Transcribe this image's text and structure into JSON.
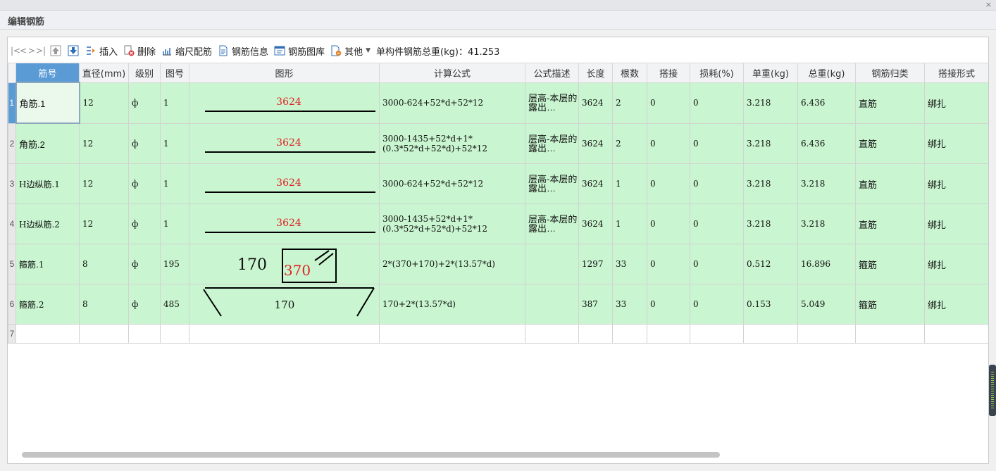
{
  "window": {
    "title": "编辑钢筋",
    "close_glyph": "×"
  },
  "toolbar": {
    "nav": [
      "|<",
      "<",
      ">",
      ">|"
    ],
    "insert": "插入",
    "delete": "删除",
    "scale_rebar": "缩尺配筋",
    "rebar_info": "钢筋信息",
    "rebar_library": "钢筋图库",
    "other": "其他",
    "total_weight": "单构件钢筋总重(kg)：41.253"
  },
  "table": {
    "columns": [
      "筋号",
      "直径(mm)",
      "级别",
      "图号",
      "图形",
      "计算公式",
      "公式描述",
      "长度",
      "根数",
      "搭接",
      "损耗(%)",
      "单重(kg)",
      "总重(kg)",
      "钢筋归类",
      "搭接形式"
    ],
    "rows": [
      {
        "num": "1",
        "name": "角筋.1",
        "dia": "12",
        "grade": "ф",
        "fig": "1",
        "shape": {
          "kind": "line",
          "label": "3624"
        },
        "formula": "3000-624+52*d+52*12",
        "desc": "层高-本层的露出…",
        "len": "3624",
        "count": "2",
        "lap": "0",
        "loss": "0",
        "unit_w": "3.218",
        "total_w": "6.436",
        "cat": "直筋",
        "lap_type": "绑扎"
      },
      {
        "num": "2",
        "name": "角筋.2",
        "dia": "12",
        "grade": "ф",
        "fig": "1",
        "shape": {
          "kind": "line",
          "label": "3624"
        },
        "formula": "3000-1435+52*d+1*(0.3*52*d+52*d)+52*12",
        "desc": "层高-本层的露出…",
        "len": "3624",
        "count": "2",
        "lap": "0",
        "loss": "0",
        "unit_w": "3.218",
        "total_w": "6.436",
        "cat": "直筋",
        "lap_type": "绑扎"
      },
      {
        "num": "3",
        "name": "H边纵筋.1",
        "dia": "12",
        "grade": "ф",
        "fig": "1",
        "shape": {
          "kind": "line",
          "label": "3624"
        },
        "formula": "3000-624+52*d+52*12",
        "desc": "层高-本层的露出…",
        "len": "3624",
        "count": "1",
        "lap": "0",
        "loss": "0",
        "unit_w": "3.218",
        "total_w": "3.218",
        "cat": "直筋",
        "lap_type": "绑扎"
      },
      {
        "num": "4",
        "name": "H边纵筋.2",
        "dia": "12",
        "grade": "ф",
        "fig": "1",
        "shape": {
          "kind": "line",
          "label": "3624"
        },
        "formula": "3000-1435+52*d+1*(0.3*52*d+52*d)+52*12",
        "desc": "层高-本层的露出…",
        "len": "3624",
        "count": "1",
        "lap": "0",
        "loss": "0",
        "unit_w": "3.218",
        "total_w": "3.218",
        "cat": "直筋",
        "lap_type": "绑扎"
      },
      {
        "num": "5",
        "name": "箍筋.1",
        "dia": "8",
        "grade": "ф",
        "fig": "195",
        "shape": {
          "kind": "stirrup",
          "label_a": "170",
          "label_b": "370"
        },
        "formula": "2*(370+170)+2*(13.57*d)",
        "desc": "",
        "len": "1297",
        "count": "33",
        "lap": "0",
        "loss": "0",
        "unit_w": "0.512",
        "total_w": "16.896",
        "cat": "箍筋",
        "lap_type": "绑扎"
      },
      {
        "num": "6",
        "name": "箍筋.2",
        "dia": "8",
        "grade": "ф",
        "fig": "485",
        "shape": {
          "kind": "tie",
          "label": "170"
        },
        "formula": "170+2*(13.57*d)",
        "desc": "",
        "len": "387",
        "count": "33",
        "lap": "0",
        "loss": "0",
        "unit_w": "0.153",
        "total_w": "5.049",
        "cat": "箍筋",
        "lap_type": "绑扎"
      }
    ],
    "empty_row": "7"
  },
  "colors": {
    "row_bg": "#c9f5d0",
    "header_hl": "#5b9bd5",
    "shape_label": "#e02020"
  },
  "icons": [
    "up-arrow-icon",
    "down-arrow-icon",
    "insert-icon",
    "delete-icon",
    "scale-icon",
    "info-icon",
    "library-icon",
    "other-icon"
  ]
}
